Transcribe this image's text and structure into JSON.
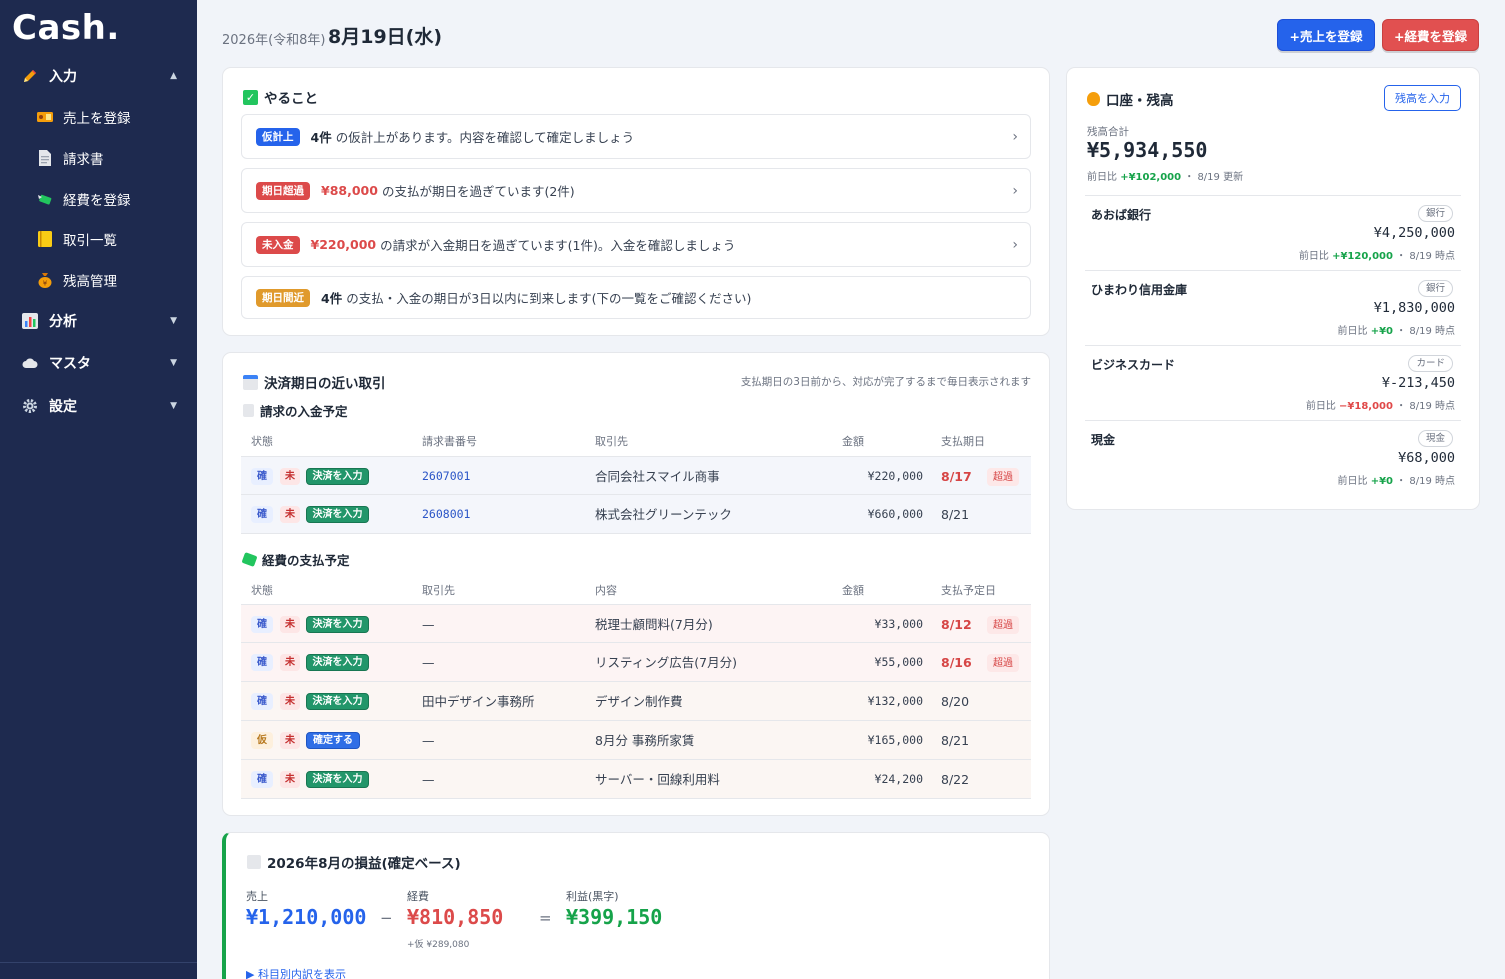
{
  "sidebar": {
    "logo": "Cash.",
    "groups": [
      {
        "label": "入力",
        "icon": "pencil-icon"
      },
      {
        "label": "分析",
        "icon": "bar-chart-icon"
      },
      {
        "label": "マスタ",
        "icon": "cloud-icon"
      },
      {
        "label": "設定",
        "icon": "gear-icon"
      }
    ],
    "items": [
      {
        "label": "売上を登録",
        "icon": "ticket-icon"
      },
      {
        "label": "請求書",
        "icon": "document-icon"
      },
      {
        "label": "経費を登録",
        "icon": "money-wings-icon"
      },
      {
        "label": "取引一覧",
        "icon": "ledger-icon"
      },
      {
        "label": "残高管理",
        "icon": "money-bag-icon"
      }
    ]
  },
  "header": {
    "year": "2026年(令和8年)",
    "date": "8月19日(水)",
    "btn_sales": "+売上を登録",
    "btn_expense": "+経費を登録"
  },
  "todo": {
    "title": "やること",
    "items": [
      {
        "tag": "仮計上",
        "tag_color": "#2563eb",
        "strong": "4件",
        "text": "の仮計上があります。内容を確認して確定しましょう"
      },
      {
        "tag": "期日超過",
        "tag_color": "#dc4a4a",
        "strong": "¥88,000",
        "text": "の支払が期日を過ぎています(2件)"
      },
      {
        "tag": "未入金",
        "tag_color": "#dc4a4a",
        "strong": "¥220,000",
        "text": "の請求が入金期日を過ぎています(1件)。入金を確認しましょう"
      },
      {
        "tag": "期日間近",
        "tag_color": "#e09a2c",
        "strong": "4件",
        "text": "の支払・入金の期日が3日以内に到来します(下の一覧をご確認ください)"
      }
    ]
  },
  "upcoming": {
    "title": "決済期日の近い取引",
    "note": "支払期日の3日前から、対応が完了するまで毎日表示されます",
    "income": {
      "title": "請求の入金予定",
      "headers": [
        "状態",
        "請求書番号",
        "取引先",
        "金額",
        "支払期日"
      ],
      "rows": [
        {
          "s1": "確",
          "s2": "未",
          "action": "決済を入力",
          "no": "2607001",
          "client": "合同会社スマイル商事",
          "amount": "¥220,000",
          "due": "8/17",
          "over": "超過"
        },
        {
          "s1": "確",
          "s2": "未",
          "action": "決済を入力",
          "no": "2608001",
          "client": "株式会社グリーンテック",
          "amount": "¥660,000",
          "due": "8/21",
          "over": ""
        }
      ]
    },
    "expense": {
      "title": "経費の支払予定",
      "headers": [
        "状態",
        "取引先",
        "内容",
        "金額",
        "支払予定日"
      ],
      "rows": [
        {
          "s1": "確",
          "s2": "未",
          "action": "決済を入力",
          "client": "—",
          "content": "税理士顧問料(7月分)",
          "amount": "¥33,000",
          "due": "8/12",
          "over": "超過"
        },
        {
          "s1": "確",
          "s2": "未",
          "action": "決済を入力",
          "client": "—",
          "content": "リスティング広告(7月分)",
          "amount": "¥55,000",
          "due": "8/16",
          "over": "超過"
        },
        {
          "s1": "確",
          "s2": "未",
          "action": "決済を入力",
          "client": "田中デザイン事務所",
          "content": "デザイン制作費",
          "amount": "¥132,000",
          "due": "8/20",
          "over": ""
        },
        {
          "s1": "仮",
          "s2": "未",
          "action": "確定する",
          "client": "—",
          "content": "8月分 事務所家賃",
          "amount": "¥165,000",
          "due": "8/21",
          "over": ""
        },
        {
          "s1": "確",
          "s2": "未",
          "action": "決済を入力",
          "client": "—",
          "content": "サーバー・回線利用料",
          "amount": "¥24,200",
          "due": "8/22",
          "over": ""
        }
      ]
    }
  },
  "pl": {
    "title": "2026年8月の損益(確定ベース)",
    "sales_label": "売上",
    "sales": "¥1,210,000",
    "minus": "−",
    "expense_label": "経費",
    "expense": "¥810,850",
    "provisional": "+仮 ¥289,080",
    "equals": "=",
    "profit_label": "利益(黒字)",
    "profit": "¥399,150",
    "toggle": "▶ 科目別内訳を表示"
  },
  "balance": {
    "title": "口座・残高",
    "btn": "残高を入力",
    "total_label": "残高合計",
    "total": "¥5,934,550",
    "diff_prefix": "前日比",
    "diff": "+¥102,000",
    "updated": "・ 8/19 更新",
    "accounts": [
      {
        "name": "あおば銀行",
        "kind": "銀行",
        "amount": "¥4,250,000",
        "diff": "+¥120,000",
        "diff_sign": "pos",
        "asof": "・ 8/19 時点"
      },
      {
        "name": "ひまわり信用金庫",
        "kind": "銀行",
        "amount": "¥1,830,000",
        "diff": "+¥0",
        "diff_sign": "pos",
        "asof": "・ 8/19 時点"
      },
      {
        "name": "ビジネスカード",
        "kind": "カード",
        "amount": "¥-213,450",
        "diff": "−¥18,000",
        "diff_sign": "neg",
        "asof": "・ 8/19 時点"
      },
      {
        "name": "現金",
        "kind": "現金",
        "amount": "¥68,000",
        "diff": "+¥0",
        "diff_sign": "pos",
        "asof": "・ 8/19 時点"
      }
    ]
  },
  "colors": {
    "sidebar_bg": "#1e2a4f",
    "primary": "#2563eb",
    "danger": "#e15050",
    "success": "#16a34a"
  }
}
